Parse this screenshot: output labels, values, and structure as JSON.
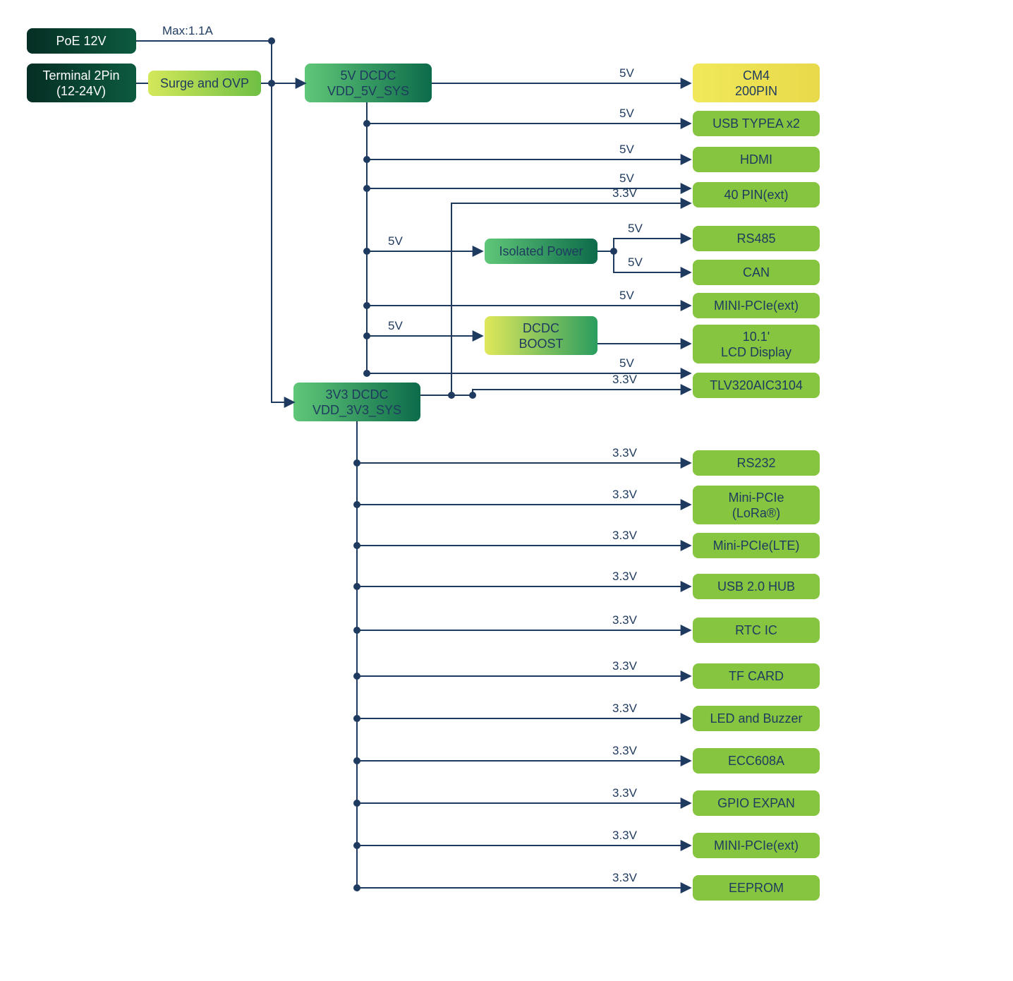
{
  "inputs": {
    "poe": "PoE 12V",
    "terminal_l1": "Terminal 2Pin",
    "terminal_l2": "(12-24V)",
    "max_label": "Max:1.1A",
    "surge": "Surge and OVP"
  },
  "regulators": {
    "dcdc5_l1": "5V DCDC",
    "dcdc5_l2": "VDD_5V_SYS",
    "dcdc3_l1": "3V3 DCDC",
    "dcdc3_l2": "VDD_3V3_SYS",
    "isolated": "Isolated Power",
    "boost_l1": "DCDC",
    "boost_l2": "BOOST"
  },
  "rails": {
    "v5": "5V",
    "v33": "3.3V"
  },
  "outputs_5v": {
    "cm4_l1": "CM4",
    "cm4_l2": "200PIN",
    "usb_typea": "USB TYPEA x2",
    "hdmi": "HDMI",
    "pin40": "40 PIN(ext)",
    "rs485": "RS485",
    "can": "CAN",
    "mini_pcie_ext": "MINI-PCIe(ext)",
    "lcd_l1": "10.1'",
    "lcd_l2": "LCD Display",
    "tlv": "TLV320AIC3104"
  },
  "outputs_3v3": {
    "rs232": "RS232",
    "mini_pcie_lora_l1": "Mini-PCIe",
    "mini_pcie_lora_l2": "(LoRa®)",
    "mini_pcie_lte": "Mini-PCIe(LTE)",
    "usb_hub": "USB 2.0 HUB",
    "rtc": "RTC IC",
    "tf": "TF CARD",
    "led_buzzer": "LED and Buzzer",
    "ecc": "ECC608A",
    "gpio": "GPIO EXPAN",
    "mini_pcie_ext2": "MINI-PCIe(ext)",
    "eeprom": "EEPROM"
  },
  "colors": {
    "darkgreen1": "#0a4d3c",
    "darkgreen2": "#0d5a3f",
    "midgreen1": "#2a9d5f",
    "midgreen2": "#1a7a4a",
    "lime": "#8bc34a",
    "lime_light": "#a8d45a",
    "yellow": "#e8e85a",
    "wire": "#1e3a5f"
  },
  "chart_data": {
    "type": "block-diagram",
    "title": "Power Distribution Block Diagram",
    "power_inputs": [
      {
        "name": "PoE 12V",
        "max_current": "1.1A"
      },
      {
        "name": "Terminal 2Pin",
        "range": "12-24V",
        "via": "Surge and OVP"
      }
    ],
    "regulators": [
      {
        "name": "5V DCDC VDD_5V_SYS",
        "input": "12-24V/PoE",
        "output": "5V"
      },
      {
        "name": "3V3 DCDC VDD_3V3_SYS",
        "input": "12-24V/PoE",
        "output": "3.3V"
      },
      {
        "name": "Isolated Power",
        "input": "5V",
        "outputs": [
          "RS485",
          "CAN"
        ]
      },
      {
        "name": "DCDC BOOST",
        "input": "5V",
        "outputs": [
          "10.1' LCD Display"
        ]
      }
    ],
    "rails": [
      {
        "voltage": "5V",
        "source": "5V DCDC",
        "loads": [
          "CM4 200PIN",
          "USB TYPEA x2",
          "HDMI",
          "40 PIN(ext)",
          "RS485 (via Isolated Power)",
          "CAN (via Isolated Power)",
          "MINI-PCIe(ext)",
          "10.1' LCD Display (via DCDC BOOST)",
          "TLV320AIC3104"
        ]
      },
      {
        "voltage": "3.3V",
        "source": "3V3 DCDC",
        "loads": [
          "40 PIN(ext)",
          "TLV320AIC3104",
          "RS232",
          "Mini-PCIe (LoRa)",
          "Mini-PCIe(LTE)",
          "USB 2.0 HUB",
          "RTC IC",
          "TF CARD",
          "LED and Buzzer",
          "ECC608A",
          "GPIO EXPAN",
          "MINI-PCIe(ext)",
          "EEPROM"
        ]
      }
    ]
  }
}
